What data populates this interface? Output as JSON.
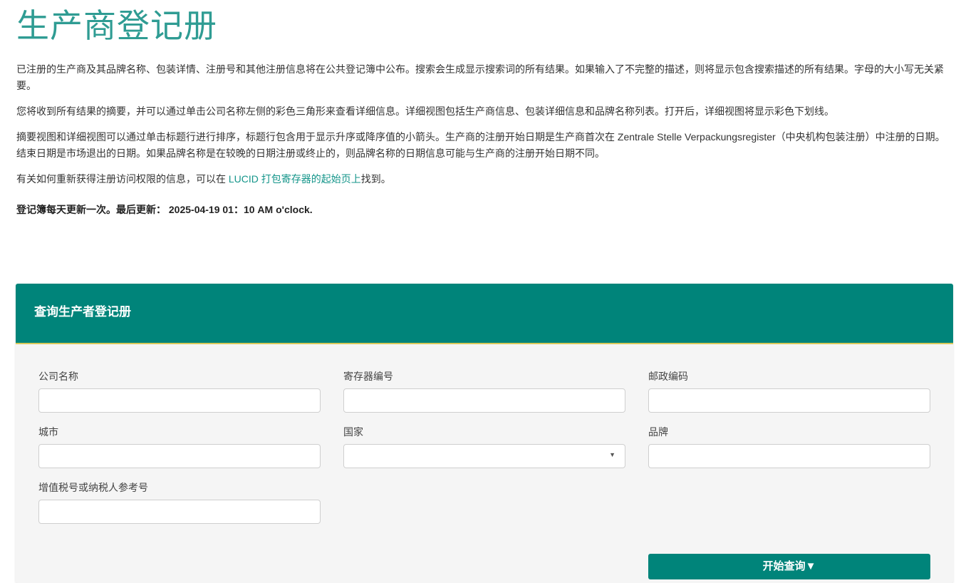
{
  "page": {
    "title": "生产商登记册",
    "paragraphs": [
      "已注册的生产商及其品牌名称、包装详情、注册号和其他注册信息将在公共登记簿中公布。搜索会生成显示搜索词的所有结果。如果输入了不完整的描述，则将显示包含搜索描述的所有结果。字母的大小写无关紧要。",
      "您将收到所有结果的摘要，并可以通过单击公司名称左侧的彩色三角形来查看详细信息。详细视图包括生产商信息、包装详细信息和品牌名称列表。打开后，详细视图将显示彩色下划线。",
      "摘要视图和详细视图可以通过单击标题行进行排序，标题行包含用于显示升序或降序值的小箭头。生产商的注册开始日期是生产商首次在 Zentrale Stelle Verpackungsregister（中央机构包装注册）中注册的日期。结束日期是市场退出的日期。如果品牌名称是在较晚的日期注册或终止的，则品牌名称的日期信息可能与生产商的注册开始日期不同。"
    ],
    "access_text_before": "有关如何重新获得注册访问权限的信息，可以在 ",
    "access_link": "LUCID 打包寄存器的起始页上",
    "access_text_after": "找到。",
    "update_notice": "登记簿每天更新一次。最后更新： 2025-04-19 01：10 AM o'clock."
  },
  "search_panel": {
    "title": "查询生产者登记册",
    "fields": {
      "company_name": "公司名称",
      "register_number": "寄存器编号",
      "postal_code": "邮政编码",
      "city": "城市",
      "country": "国家",
      "brand": "品牌",
      "vat_number": "增值税号或纳税人参考号"
    },
    "submit_label": "开始查询▼"
  },
  "colors": {
    "title": "#2f9c93",
    "header": "#00847a",
    "header_border": "#d9c95a",
    "link": "#14958a"
  }
}
